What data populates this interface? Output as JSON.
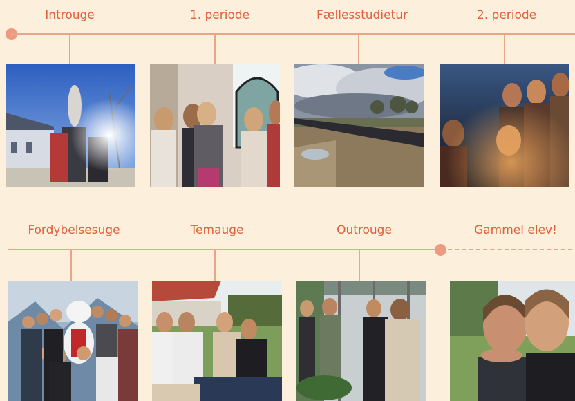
{
  "timeline": {
    "row1": [
      {
        "label": "Introuge"
      },
      {
        "label": "1. periode"
      },
      {
        "label": "Fællesstudietur"
      },
      {
        "label": "2. periode"
      }
    ],
    "row2": [
      {
        "label": "Fordybelsesuge"
      },
      {
        "label": "Temauge"
      },
      {
        "label": "Outrouge"
      },
      {
        "label": "Gammel  elev!"
      }
    ]
  },
  "colors": {
    "background": "#fcefdc",
    "label": "#e0603e",
    "line": "#e9a489",
    "dot": "#ed9b80"
  },
  "icons": {
    "photos": [
      "intro-week-photo-icon",
      "first-period-photo-icon",
      "study-trip-photo-icon",
      "second-period-photo-icon",
      "deep-dive-week-photo-icon",
      "theme-week-photo-icon",
      "outro-week-photo-icon",
      "alumni-photo-icon"
    ]
  }
}
